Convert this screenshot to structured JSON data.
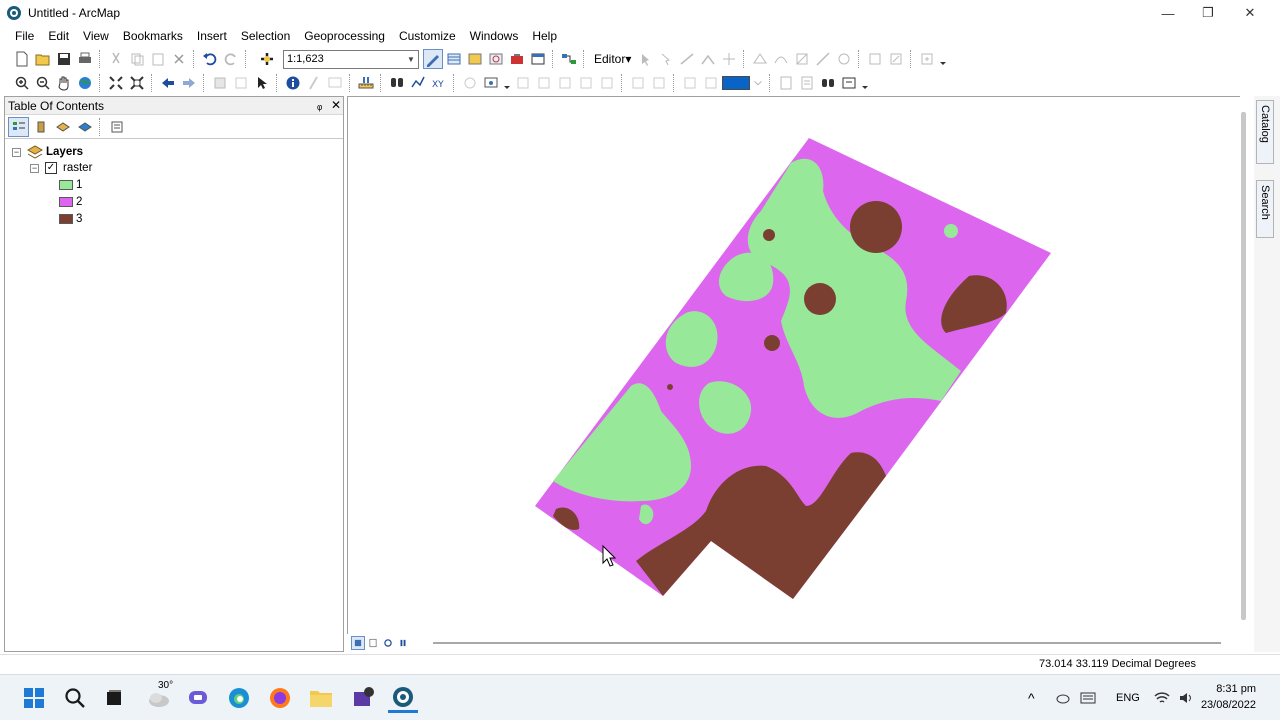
{
  "window": {
    "title": "Untitled - ArcMap",
    "minimize": "—",
    "restore": "❐",
    "close": "✕"
  },
  "menu": [
    "File",
    "Edit",
    "View",
    "Bookmarks",
    "Insert",
    "Selection",
    "Geoprocessing",
    "Customize",
    "Windows",
    "Help"
  ],
  "toolbar": {
    "scale_value": "1:1,623",
    "editor_label": "Editor▾"
  },
  "toc": {
    "title": "Table Of Contents",
    "pin": "ᵩ",
    "close": "✕",
    "root_label": "Layers",
    "layer_label": "raster",
    "layer_checked": true,
    "legend": [
      {
        "label": "1",
        "color": "#98e89a"
      },
      {
        "label": "2",
        "color": "#dd66ee"
      },
      {
        "label": "3",
        "color": "#7b3f32"
      }
    ]
  },
  "side_tabs": {
    "catalog": "Catalog",
    "search": "Search"
  },
  "status": {
    "coordinates": "73.014  33.119 Decimal Degrees"
  },
  "taskbar": {
    "weather_temp": "30°",
    "language": "ENG",
    "time": "8:31 pm",
    "date": "23/08/2022"
  },
  "colors": {
    "class1": "#98e89a",
    "class2": "#dd66ee",
    "class3": "#7b3f32",
    "accent": "#0a64c8"
  }
}
